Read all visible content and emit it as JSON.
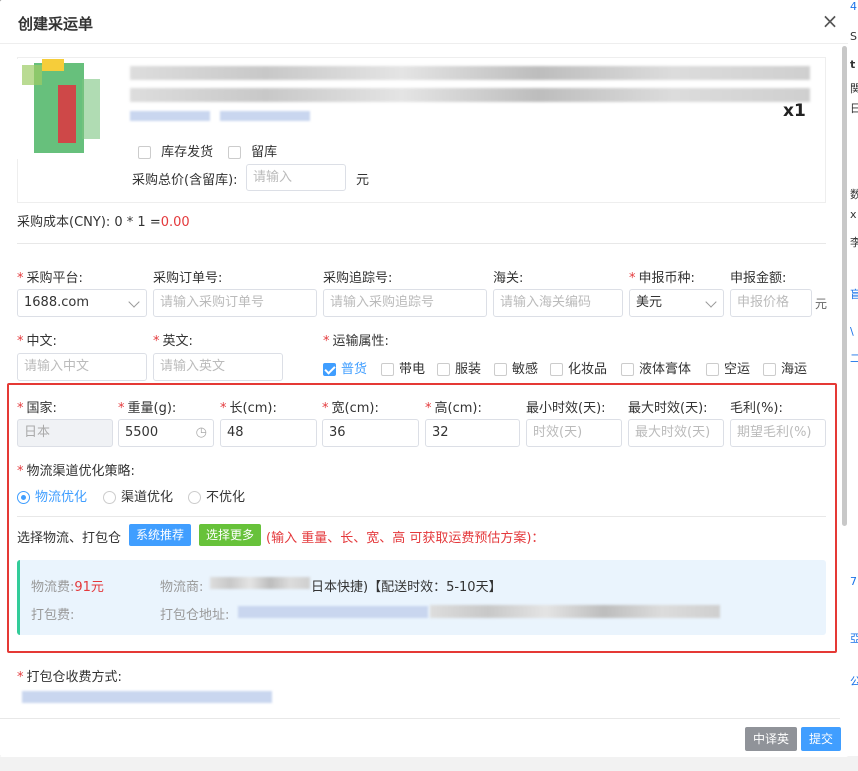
{
  "dialog": {
    "title": "创建采运单",
    "close": "×"
  },
  "product": {
    "qty": "x1",
    "options": [
      {
        "label": "库存发货",
        "checked": false
      },
      {
        "label": "留库",
        "checked": false
      }
    ],
    "total_label": "采购总价(含留库):",
    "total_placeholder": "请输入",
    "total_unit": "元",
    "cost_label": "采购成本(CNY): 0 * 1 =",
    "cost_value": "0.00"
  },
  "form1": {
    "platform": {
      "label": "采购平台:",
      "value": "1688.com"
    },
    "order_no": {
      "label": "采购订单号:",
      "placeholder": "请输入采购订单号"
    },
    "tracking": {
      "label": "采购追踪号:",
      "placeholder": "请输入采购追踪号"
    },
    "customs": {
      "label": "海关:",
      "placeholder": "请输入海关编码"
    },
    "currency": {
      "label": "申报币种:",
      "value": "美元"
    },
    "amount": {
      "label": "申报金额:",
      "placeholder": "申报价格",
      "unit": "元"
    },
    "cn": {
      "label": "中文:",
      "placeholder": "请输入中文"
    },
    "en": {
      "label": "英文:",
      "placeholder": "请输入英文"
    },
    "transport": {
      "label": "运输属性:",
      "items": [
        {
          "label": "普货",
          "checked": true
        },
        {
          "label": "带电",
          "checked": false
        },
        {
          "label": "服装",
          "checked": false
        },
        {
          "label": "敏感",
          "checked": false
        },
        {
          "label": "化妆品",
          "checked": false
        },
        {
          "label": "液体膏体",
          "checked": false
        },
        {
          "label": "空运",
          "checked": false
        },
        {
          "label": "海运",
          "checked": false
        }
      ]
    }
  },
  "logistics": {
    "country": {
      "label": "国家:",
      "value": "日本"
    },
    "weight": {
      "label": "重量(g):",
      "value": "5500"
    },
    "length": {
      "label": "长(cm):",
      "value": "48"
    },
    "width": {
      "label": "宽(cm):",
      "value": "36"
    },
    "height": {
      "label": "高(cm):",
      "value": "32"
    },
    "min_days": {
      "label": "最小时效(天):",
      "placeholder": "时效(天)"
    },
    "max_days": {
      "label": "最大时效(天):",
      "placeholder": "最大时效(天)"
    },
    "margin": {
      "label": "毛利(%):",
      "placeholder": "期望毛利(%)"
    },
    "strategy": {
      "label": "物流渠道优化策略:",
      "options": [
        {
          "label": "物流优化",
          "selected": true
        },
        {
          "label": "渠道优化",
          "selected": false
        },
        {
          "label": "不优化",
          "selected": false
        }
      ]
    },
    "select_label": "选择物流、打包仓",
    "btn_recommend": "系统推荐",
    "btn_more": "选择更多",
    "hint": "(输入 重量、长、宽、高 可获取运费预估方案)：",
    "fee_label": "物流费:",
    "fee_value": "91元",
    "carrier_label": "物流商:",
    "carrier_value": "日本快捷)【配送时效：5-10天】",
    "pack_fee_label": "打包费:",
    "warehouse_label": "打包仓地址:"
  },
  "pack_fee_method": {
    "label": "打包仓收费方式:"
  },
  "footer": {
    "translate": "中译英",
    "submit": "提交"
  },
  "colors": {
    "primary": "#409eff",
    "green": "#67c23a",
    "danger": "#e4393c",
    "frame": "#e53935"
  }
}
